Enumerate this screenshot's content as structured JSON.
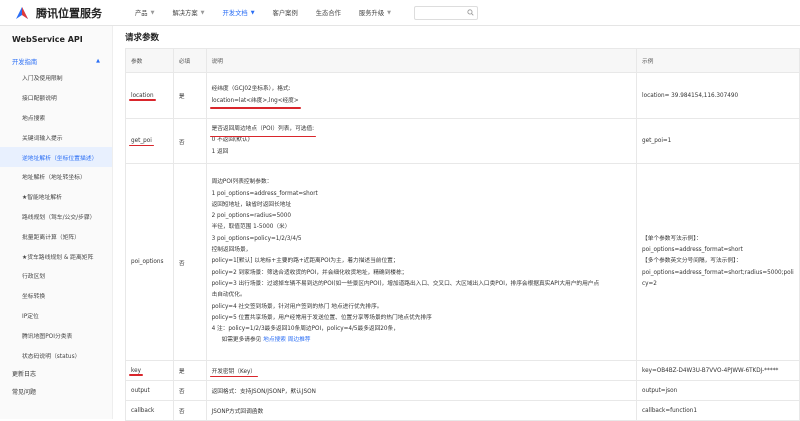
{
  "header": {
    "logo_text": "腾讯位置服务",
    "nav": [
      {
        "label": "产品",
        "active": false
      },
      {
        "label": "解决方案",
        "active": false
      },
      {
        "label": "开发文档",
        "active": true
      },
      {
        "label": "客户案例",
        "active": false
      },
      {
        "label": "生态合作",
        "active": false
      },
      {
        "label": "服务升级",
        "active": false
      }
    ]
  },
  "sidebar": {
    "title": "WebService API",
    "group": "开发指南",
    "items": [
      "入门及使用限制",
      "接口配额说明",
      "地点搜索",
      "关键词输入提示",
      "逆地址解析（坐标位置描述）",
      "地址解析（地址转坐标）",
      "★智能地址解析",
      "路线规划（驾车/公交/步骤）",
      "批量距离计算（矩阵）",
      "★货车路线规划 & 距离矩阵",
      "行政区划",
      "坐标转换",
      "IP定位",
      "腾讯地图POI分类表",
      "状态码说明（status）"
    ],
    "active_index": 4,
    "root_items": [
      "更新日志",
      "常见问题"
    ]
  },
  "main": {
    "title": "请求参数",
    "headers": [
      "参数",
      "必填",
      "说明",
      "示例"
    ],
    "rows": [
      {
        "param": "location",
        "required": "是",
        "desc": [
          "经纬度（GCJ02坐标系），格式:",
          "location=lat<纬度>,lng<经度>"
        ],
        "example": [
          "location= 39.984154,116.307490"
        ]
      },
      {
        "param": "get_poi",
        "required": "否",
        "desc": [
          "是否返回周边地点（POI）列表，可选值:",
          "0 不返回(默认)",
          "1 返回"
        ],
        "example": [
          "get_poi=1"
        ]
      },
      {
        "param": "poi_options",
        "required": "否",
        "desc": [
          "周边POI列表控制参数：",
          "1 poi_options=address_format=short",
          "返回短地址，缺省时返回长地址",
          "2 poi_options=radius=5000",
          "半径，取值范围 1-5000（米）",
          "3 poi_options=policy=1/2/3/4/5",
          "控制返回场景，",
          "policy=1[默认] 以地标+主要的路+近距离POI为主，着力描述当前位置；",
          "policy=2 到家场景：筛选合适收货的POI，并会细化收货地址，精确到楼栋；",
          "policy=3 出行场景：过滤掉车辆不易到达的POI(如一些景区内POI)，增加道路出入口、交叉口、大区域出入口类POI，排序会根据真实API大用户的用户点",
          "击自动优化。",
          "policy=4 社交签到场景，针对用户签到的热门 地点进行优先排序。",
          "policy=5 位置共享场景，用户经常用于发送位置、位置分享等场景的热门地点优先排序",
          "4 注：policy=1/2/3最多返回10条周边POI，policy=4/5最多返回20条，",
          "如需更多请参见"
        ],
        "desc_links": [
          "地点搜索",
          "周边推荐"
        ],
        "example": [
          "【单个参数写法示例】：",
          "poi_options=address_format=short",
          "【多个参数英文分号间隔，写法示例】：",
          "poi_options=address_format=short;radius=5000;poli",
          "cy=2"
        ]
      },
      {
        "param": "key",
        "required": "是",
        "desc": [
          "开发密钥（Key）"
        ],
        "example": [
          "key=OB4BZ-D4W3U-B7VVO-4PJWW-6TKDJ-*****"
        ]
      },
      {
        "param": "output",
        "required": "否",
        "desc": [
          "返回格式：支持JSON/JSONP，默认JSON"
        ],
        "example": [
          "output=json"
        ]
      },
      {
        "param": "callback",
        "required": "否",
        "desc": [
          "JSONP方式回调函数"
        ],
        "example": [
          "callback=function1"
        ]
      }
    ]
  },
  "colors": {
    "accent": "#2a6ef5",
    "annotation": "#d9262c",
    "active_bg": "#e8f0fe"
  }
}
